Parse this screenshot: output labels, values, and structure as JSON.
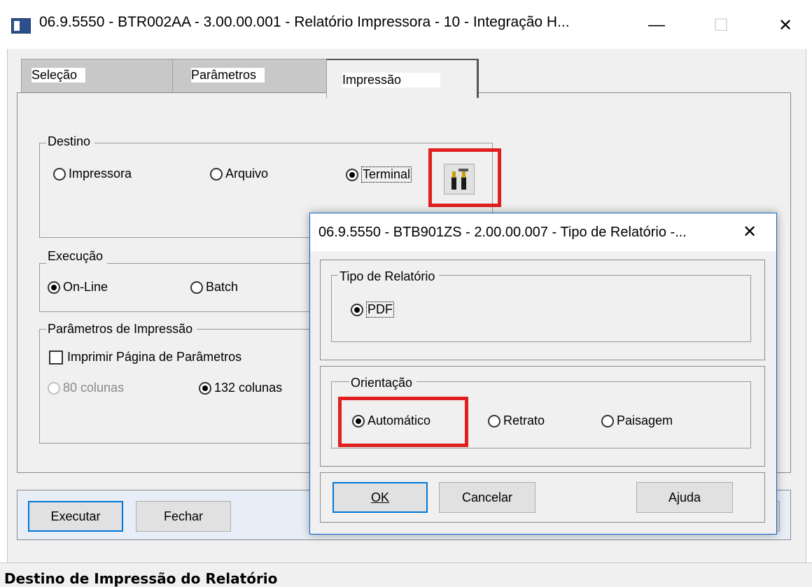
{
  "main_window": {
    "title": "06.9.5550 - BTR002AA - 3.00.00.001 - Relatório Impressora - 10 - Integração H...",
    "minimize_glyph": "—",
    "maximize_glyph": "☐",
    "close_glyph": "✕",
    "tabs": [
      {
        "label": "Seleção",
        "active": false
      },
      {
        "label": "Parâmetros",
        "active": false
      },
      {
        "label": "Impressão",
        "active": true
      }
    ],
    "destino": {
      "legend": "Destino",
      "options": [
        "Impressora",
        "Arquivo",
        "Terminal"
      ],
      "selected": "Terminal",
      "settings_icon": "tools-icon"
    },
    "execucao": {
      "legend": "Execução",
      "options": [
        "On-Line",
        "Batch"
      ],
      "selected": "On-Line"
    },
    "parametros_impressao": {
      "legend": "Parâmetros de Impressão",
      "checkbox_label": "Imprimir Página de Parâmetros",
      "checkbox_checked": false,
      "columns_options": [
        "80 colunas",
        "132 colunas"
      ],
      "columns_selected": "132 colunas"
    },
    "buttons": {
      "executar": "Executar",
      "fechar": "Fechar"
    },
    "status_text": "Destino de Impressão do Relatório"
  },
  "dialog": {
    "title": "06.9.5550 - BTB901ZS - 2.00.00.007 - Tipo de Relatório -...",
    "close_glyph": "✕",
    "tipo": {
      "legend": "Tipo de Relatório",
      "option": "PDF",
      "selected": true
    },
    "orientacao": {
      "legend": "Orientação",
      "options": [
        "Automático",
        "Retrato",
        "Paisagem"
      ],
      "selected": "Automático"
    },
    "buttons": {
      "ok": "OK",
      "cancelar": "Cancelar",
      "ajuda": "Ajuda"
    }
  },
  "colors": {
    "highlight": "#e02020",
    "accent": "#0078d7"
  }
}
